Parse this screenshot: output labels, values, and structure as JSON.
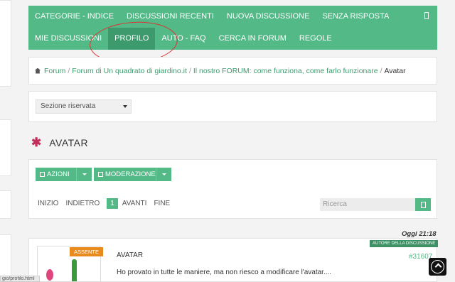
{
  "nav": {
    "row1": [
      "CATEGORIE - INDICE",
      "DISCUSSIONI RECENTI",
      "NUOVA DISCUSSIONE",
      "SENZA RISPOSTA"
    ],
    "row2": [
      "MIE DISCUSSIONI",
      "PROFILO",
      "AUTO - FAQ",
      "CERCA IN FORUM",
      "REGOLE"
    ],
    "active": "PROFILO",
    "accent_color": "#53b987"
  },
  "breadcrumb": {
    "items": [
      "Forum",
      "Forum di Un quadrato di giardino.it",
      "Il nostro FORUM: come funziona, come farlo funzionare"
    ],
    "current": "Avatar"
  },
  "section": {
    "selected": "Sezione riservata"
  },
  "page": {
    "title": "AVATAR"
  },
  "toolbar": {
    "actions_label": "AZIONI",
    "moderation_label": "MODERAZIONE",
    "pager": {
      "first": "INIZIO",
      "prev": "INDIETRO",
      "current": "1",
      "next": "AVANTI",
      "last": "FINE"
    },
    "search_placeholder": "Ricerca"
  },
  "post": {
    "time": "Oggi 21:18",
    "author_badge": "AUTORE DELLA DISCUSSIONE",
    "status_badge": "ASSENTE",
    "title": "AVATAR",
    "number": "#31607",
    "text": "Ho provato in tutte le maniere, ma non riesco a modificare l'avatar...."
  },
  "status_bar": {
    "url": "gio/profilo.html"
  }
}
